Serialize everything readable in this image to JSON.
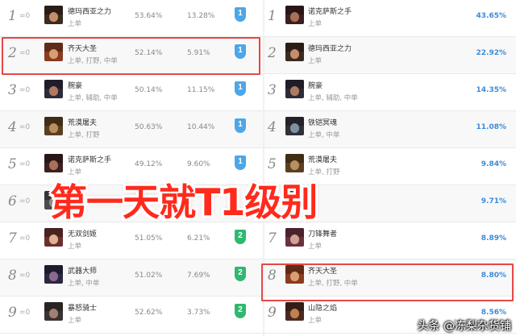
{
  "left_rows": [
    {
      "rank": "1",
      "change": "=0",
      "name": "德玛西亚之力",
      "roles": "上单",
      "winrate": "53.64%",
      "pickrate": "13.28%",
      "tier": "1",
      "c1": "#3a2a20",
      "c2": "#c58d6a"
    },
    {
      "rank": "2",
      "change": "=0",
      "name": "齐天大圣",
      "roles": "上单, 打野, 中单",
      "winrate": "52.14%",
      "pickrate": "5.91%",
      "tier": "1",
      "c1": "#8a3b22",
      "c2": "#d8a070"
    },
    {
      "rank": "3",
      "change": "=0",
      "name": "腕豪",
      "roles": "上单, 辅助, 中单",
      "winrate": "50.14%",
      "pickrate": "11.15%",
      "tier": "1",
      "c1": "#2d2a3a",
      "c2": "#b07a60"
    },
    {
      "rank": "4",
      "change": "=0",
      "name": "荒漠屠夫",
      "roles": "上单, 打野",
      "winrate": "50.63%",
      "pickrate": "10.44%",
      "tier": "1",
      "c1": "#5a4020",
      "c2": "#b89060"
    },
    {
      "rank": "5",
      "change": "=0",
      "name": "诺克萨斯之手",
      "roles": "上单",
      "winrate": "49.12%",
      "pickrate": "9.60%",
      "tier": "1",
      "c1": "#3b2020",
      "c2": "#a87058"
    },
    {
      "rank": "6",
      "change": "=0",
      "name": "",
      "roles": "",
      "winrate": "",
      "pickrate": "",
      "tier": "",
      "c1": "#4a4a50",
      "c2": "#9a8a80"
    },
    {
      "rank": "7",
      "change": "=0",
      "name": "无双剑姬",
      "roles": "上单",
      "winrate": "51.05%",
      "pickrate": "6.21%",
      "tier": "2",
      "c1": "#6a3030",
      "c2": "#e0b090"
    },
    {
      "rank": "8",
      "change": "=0",
      "name": "武器大师",
      "roles": "上单, 中单",
      "winrate": "51.02%",
      "pickrate": "7.69%",
      "tier": "2",
      "c1": "#2a2840",
      "c2": "#8a6a90"
    },
    {
      "rank": "9",
      "change": "=0",
      "name": "暴怒骑士",
      "roles": "上单",
      "winrate": "52.62%",
      "pickrate": "3.73%",
      "tier": "2",
      "c1": "#3a3230",
      "c2": "#a08070"
    }
  ],
  "right_rows": [
    {
      "rank": "1",
      "name": "诺克萨斯之手",
      "roles": "上单",
      "pct": "43.65%",
      "c1": "#3b2020",
      "c2": "#a87058"
    },
    {
      "rank": "2",
      "name": "德玛西亚之力",
      "roles": "上单",
      "pct": "22.92%",
      "c1": "#3a2a20",
      "c2": "#c58d6a"
    },
    {
      "rank": "3",
      "name": "腕豪",
      "roles": "上单, 辅助, 中单",
      "pct": "14.35%",
      "c1": "#2d2a3a",
      "c2": "#b07a60"
    },
    {
      "rank": "4",
      "name": "铁铠冥魂",
      "roles": "上单, 中单",
      "pct": "11.08%",
      "c1": "#30303a",
      "c2": "#8090a0"
    },
    {
      "rank": "5",
      "name": "荒漠屠夫",
      "roles": "上单, 打野",
      "pct": "9.84%",
      "c1": "#5a4020",
      "c2": "#b89060"
    },
    {
      "rank": "6",
      "name": "",
      "roles": "",
      "pct": "9.71%",
      "c1": "#4a4a50",
      "c2": "#9a8a80"
    },
    {
      "rank": "7",
      "name": "刀锋舞者",
      "roles": "上单",
      "pct": "8.89%",
      "c1": "#6a3040",
      "c2": "#d0a090"
    },
    {
      "rank": "8",
      "name": "齐天大圣",
      "roles": "上单, 打野, 中单",
      "pct": "8.80%",
      "c1": "#8a3b22",
      "c2": "#d8a070"
    },
    {
      "rank": "9",
      "name": "山隐之焰",
      "roles": "上单",
      "pct": "8.56%",
      "c1": "#4a2a20",
      "c2": "#c08050"
    }
  ],
  "banner": "第一天就T1级别",
  "watermark": "头条 @冻梨杂货铺",
  "colors": {
    "tier1": "#4da6e8",
    "tier2": "#2fb86f",
    "highlight": "#e54848",
    "banner": "#ff2a1c",
    "percent": "#3b8cd9"
  }
}
